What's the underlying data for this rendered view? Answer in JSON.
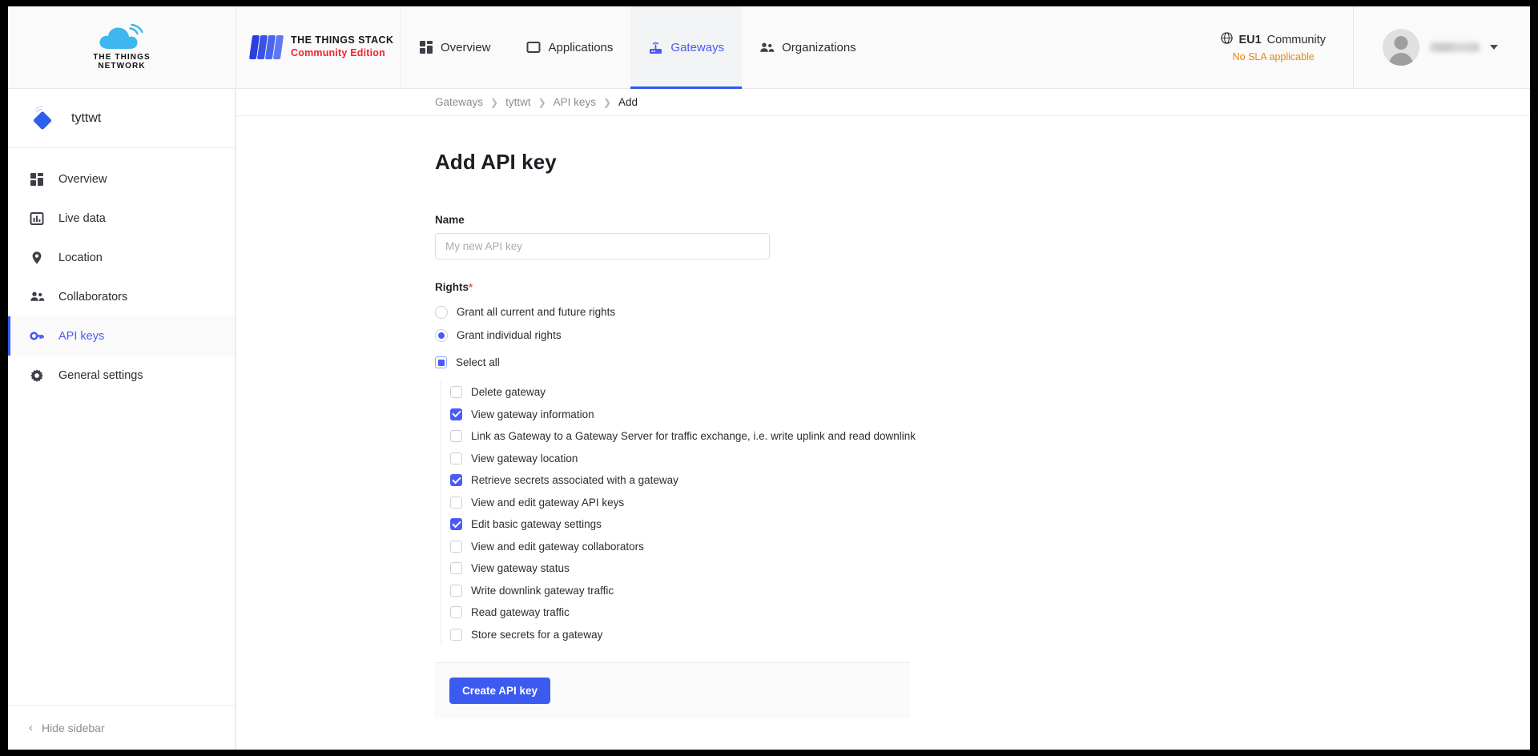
{
  "brand": {
    "ttn_line1": "THE THINGS",
    "ttn_line2": "NETWORK",
    "stack_title": "THE THINGS STACK",
    "stack_subtitle": "Community Edition",
    "stack_subtitle_color": "#f4222d",
    "accent_blue": "#3b5bf0",
    "link_blue": "#4a5bf5"
  },
  "topnav": {
    "tabs": [
      {
        "label": "Overview",
        "icon": "grid-icon",
        "active": false
      },
      {
        "label": "Applications",
        "icon": "application-icon",
        "active": false
      },
      {
        "label": "Gateways",
        "icon": "gateway-icon",
        "active": true
      },
      {
        "label": "Organizations",
        "icon": "organizations-icon",
        "active": false
      }
    ],
    "cluster": "EU1",
    "cluster_suffix": "Community",
    "sla": "No SLA applicable",
    "sla_color": "#e5870d",
    "user_name": ""
  },
  "sidebar": {
    "entity_name": "tyttwt",
    "items": [
      {
        "label": "Overview",
        "icon": "grid-icon",
        "active": false
      },
      {
        "label": "Live data",
        "icon": "chart-icon",
        "active": false
      },
      {
        "label": "Location",
        "icon": "location-pin-icon",
        "active": false
      },
      {
        "label": "Collaborators",
        "icon": "collaborators-icon",
        "active": false
      },
      {
        "label": "API keys",
        "icon": "key-icon",
        "active": true
      },
      {
        "label": "General settings",
        "icon": "gear-icon",
        "active": false
      }
    ],
    "hide_label": "Hide sidebar"
  },
  "breadcrumb": [
    {
      "label": "Gateways",
      "last": false
    },
    {
      "label": "tyttwt",
      "last": false
    },
    {
      "label": "API keys",
      "last": false
    },
    {
      "label": "Add",
      "last": true
    }
  ],
  "page": {
    "title": "Add API key"
  },
  "form": {
    "name_label": "Name",
    "name_value": "",
    "name_placeholder": "My new API key",
    "rights_label": "Rights",
    "required_marker": "*",
    "radio_options": [
      {
        "label": "Grant all current and future rights",
        "selected": false
      },
      {
        "label": "Grant individual rights",
        "selected": true
      }
    ],
    "select_all": {
      "label": "Select all",
      "state": "indeterminate"
    },
    "rights": [
      {
        "label": "Delete gateway",
        "checked": false
      },
      {
        "label": "View gateway information",
        "checked": true
      },
      {
        "label": "Link as Gateway to a Gateway Server for traffic exchange, i.e. write uplink and read downlink",
        "checked": false
      },
      {
        "label": "View gateway location",
        "checked": false
      },
      {
        "label": "Retrieve secrets associated with a gateway",
        "checked": true
      },
      {
        "label": "View and edit gateway API keys",
        "checked": false
      },
      {
        "label": "Edit basic gateway settings",
        "checked": true
      },
      {
        "label": "View and edit gateway collaborators",
        "checked": false
      },
      {
        "label": "View gateway status",
        "checked": false
      },
      {
        "label": "Write downlink gateway traffic",
        "checked": false
      },
      {
        "label": "Read gateway traffic",
        "checked": false
      },
      {
        "label": "Store secrets for a gateway",
        "checked": false
      }
    ],
    "submit_label": "Create API key"
  }
}
